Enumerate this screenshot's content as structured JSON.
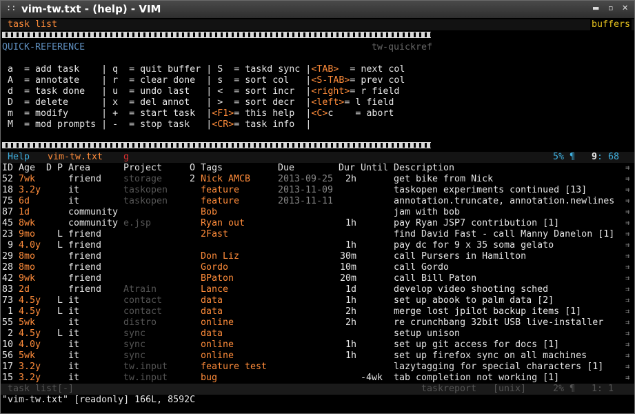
{
  "window": {
    "title": "vim-tw.txt - (help) - VIM",
    "grip": "::",
    "min": "▬",
    "max": "▫",
    "close": "✕"
  },
  "tabs": {
    "active": "task list",
    "buffers": "buffers"
  },
  "quickref": {
    "title": "QUICK-REFERENCE",
    "tag": "tw-quickref",
    "lines": [
      [
        " a  = add task    | q  = quit buffer | S  = taskd sync |",
        "<TAB>",
        "  = next col"
      ],
      [
        " A  = annotate    | r  = clear done  | s  = sort col   |",
        "<S-TAB>",
        "= prev col"
      ],
      [
        " d  = task done   | u  = undo last   | <  = sort incr  |",
        "<right>",
        "= r field"
      ],
      [
        " D  = delete      | x  = del annot   | >  = sort decr  |",
        "<left>",
        "= l field"
      ],
      [
        " m  = modify      | +  = start task  |",
        "<F1>",
        "= this help  |",
        "<C>",
        "c    = abort"
      ],
      [
        " M  = mod prompts | -  = stop task   |",
        "<CR>",
        "= task info  |"
      ]
    ]
  },
  "status_help": {
    "help": "Help",
    "file": "vim-tw.txt",
    "modified": "g",
    "percent": "5% ¶",
    "line": "9",
    "col": ": 68"
  },
  "table": {
    "headers": {
      "id": "ID",
      "age": "Age",
      "d": "D",
      "p": "P",
      "area": "Area",
      "project": "Project",
      "o": "O",
      "tags": "Tags",
      "due": "Due",
      "dur": "Dur",
      "until": "Until",
      "desc": "Description"
    },
    "right_marker": "⇉",
    "rows": [
      {
        "id": "52",
        "age": "7wk",
        "d": "",
        "p": "",
        "area": "friend",
        "project": "storage",
        "o": "2",
        "tags": "Nick AMCB",
        "due": "2013-09-25",
        "dur": "2h",
        "until": "",
        "desc": "get bike from Nick"
      },
      {
        "id": "18",
        "age": "3.2y",
        "d": "",
        "p": "",
        "area": "it",
        "project": "taskopen",
        "o": "",
        "tags": "feature",
        "due": "2013-11-09",
        "dur": "",
        "until": "",
        "desc": "taskopen experiments continued [13]"
      },
      {
        "id": "75",
        "age": "6d",
        "d": "",
        "p": "",
        "area": "it",
        "project": "taskopen",
        "o": "",
        "tags": "feature",
        "due": "2013-11-11",
        "dur": "",
        "until": "",
        "desc": "annotation.truncate, annotation.newlines"
      },
      {
        "id": "87",
        "age": "1d",
        "d": "",
        "p": "",
        "area": "community",
        "project": "",
        "o": "",
        "tags": "Bob",
        "due": "",
        "dur": "",
        "until": "",
        "desc": "jam with bob"
      },
      {
        "id": "45",
        "age": "8wk",
        "d": "",
        "p": "",
        "area": "community",
        "project": "e.jsp",
        "o": "",
        "tags": "Ryan out",
        "due": "",
        "dur": "1h",
        "until": "",
        "desc": "pay Ryan JSP7 contribution [1]"
      },
      {
        "id": "23",
        "age": "9mo",
        "d": "",
        "p": "L",
        "area": "friend",
        "project": "",
        "o": "",
        "tags": "2Fast",
        "due": "",
        "dur": "",
        "until": "",
        "desc": "find David Fast - call Manny Danelon [1]"
      },
      {
        "id": " 9",
        "age": "4.0y",
        "d": "",
        "p": "L",
        "area": "friend",
        "project": "",
        "o": "",
        "tags": "",
        "due": "",
        "dur": "1h",
        "until": "",
        "desc": "pay dc for 9 x 35 soma gelato"
      },
      {
        "id": "29",
        "age": "8mo",
        "d": "",
        "p": "",
        "area": "friend",
        "project": "",
        "o": "",
        "tags": "Don Liz",
        "due": "",
        "dur": "30m",
        "until": "",
        "desc": "call Pursers in Hamilton"
      },
      {
        "id": "28",
        "age": "8mo",
        "d": "",
        "p": "",
        "area": "friend",
        "project": "",
        "o": "",
        "tags": "Gordo",
        "due": "",
        "dur": "10m",
        "until": "",
        "desc": "call Gordo"
      },
      {
        "id": "42",
        "age": "9wk",
        "d": "",
        "p": "",
        "area": "friend",
        "project": "",
        "o": "",
        "tags": "BPaton",
        "due": "",
        "dur": "20m",
        "until": "",
        "desc": "call Bill Paton"
      },
      {
        "id": "83",
        "age": "2d",
        "d": "",
        "p": "",
        "area": "friend",
        "project": "Atrain",
        "o": "",
        "tags": "Lance",
        "due": "",
        "dur": "1d",
        "until": "",
        "desc": "develop video shooting sched"
      },
      {
        "id": "73",
        "age": "4.5y",
        "d": "",
        "p": "L",
        "area": "it",
        "project": "contact",
        "o": "",
        "tags": "data",
        "due": "",
        "dur": "1h",
        "until": "",
        "desc": "set up abook to palm data [2]"
      },
      {
        "id": " 1",
        "age": "4.5y",
        "d": "",
        "p": "L",
        "area": "it",
        "project": "contact",
        "o": "",
        "tags": "data",
        "due": "",
        "dur": "2h",
        "until": "",
        "desc": "merge lost jpilot backup items [1]"
      },
      {
        "id": "55",
        "age": "5wk",
        "d": "",
        "p": "",
        "area": "it",
        "project": "distro",
        "o": "",
        "tags": "online",
        "due": "",
        "dur": "2h",
        "until": "",
        "desc": "re crunchbang 32bit USB live-installer"
      },
      {
        "id": " 2",
        "age": "4.5y",
        "d": "",
        "p": "L",
        "area": "it",
        "project": "sync",
        "o": "",
        "tags": "data",
        "due": "",
        "dur": "",
        "until": "",
        "desc": "setup unison"
      },
      {
        "id": "10",
        "age": "4.0y",
        "d": "",
        "p": "",
        "area": "it",
        "project": "sync",
        "o": "",
        "tags": "online",
        "due": "",
        "dur": "1h",
        "until": "",
        "desc": "set up git access for docs [1]"
      },
      {
        "id": "56",
        "age": "5wk",
        "d": "",
        "p": "",
        "area": "it",
        "project": "sync",
        "o": "",
        "tags": "online",
        "due": "",
        "dur": "1h",
        "until": "",
        "desc": "set up firefox sync on all machines"
      },
      {
        "id": "17",
        "age": "3.2y",
        "d": "",
        "p": "",
        "area": "it",
        "project": "tw.input",
        "o": "",
        "tags": "feature test",
        "due": "",
        "dur": "",
        "until": "",
        "desc": "lazytagging for special characters [1]"
      },
      {
        "id": "15",
        "age": "3.2y",
        "d": "",
        "p": "",
        "area": "it",
        "project": "tw.input",
        "o": "",
        "tags": "bug",
        "due": "",
        "dur": "",
        "until": "-4wk",
        "desc": "tab completion not working [1]"
      }
    ]
  },
  "status_task": {
    "name": "task list[-]",
    "type": "taskreport",
    "fileformat": "[unix]",
    "percent": "2% ¶",
    "pos": "1:  1"
  },
  "cmdline": "\"vim-tw.txt\" [readonly] 166L, 8592C"
}
